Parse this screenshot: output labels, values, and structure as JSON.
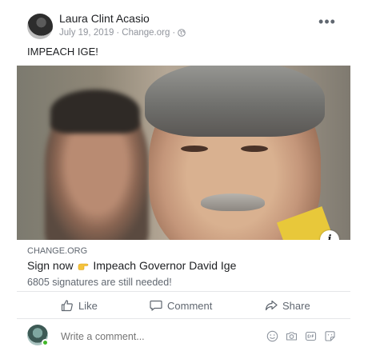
{
  "post": {
    "author": "Laura Clint Acasio",
    "date": "July 19, 2019",
    "source": "Change.org",
    "separator": "·",
    "privacy_icon": "globe-icon",
    "more_icon": "•••",
    "text": "IMPEACH IGE!"
  },
  "link": {
    "domain": "CHANGE.ORG",
    "title_before": "Sign now",
    "title_emoji": "pointing-hand-icon",
    "title_after": "Impeach Governor David Ige",
    "description": "6805 signatures are still needed!",
    "info_icon": "i"
  },
  "actions": {
    "like": "Like",
    "comment": "Comment",
    "share": "Share"
  },
  "comment_box": {
    "placeholder": "Write a comment...",
    "icons": [
      "emoji-icon",
      "camera-icon",
      "gif-icon",
      "sticker-icon"
    ]
  },
  "colors": {
    "secondary_text": "#606770",
    "online": "#42b72a"
  }
}
